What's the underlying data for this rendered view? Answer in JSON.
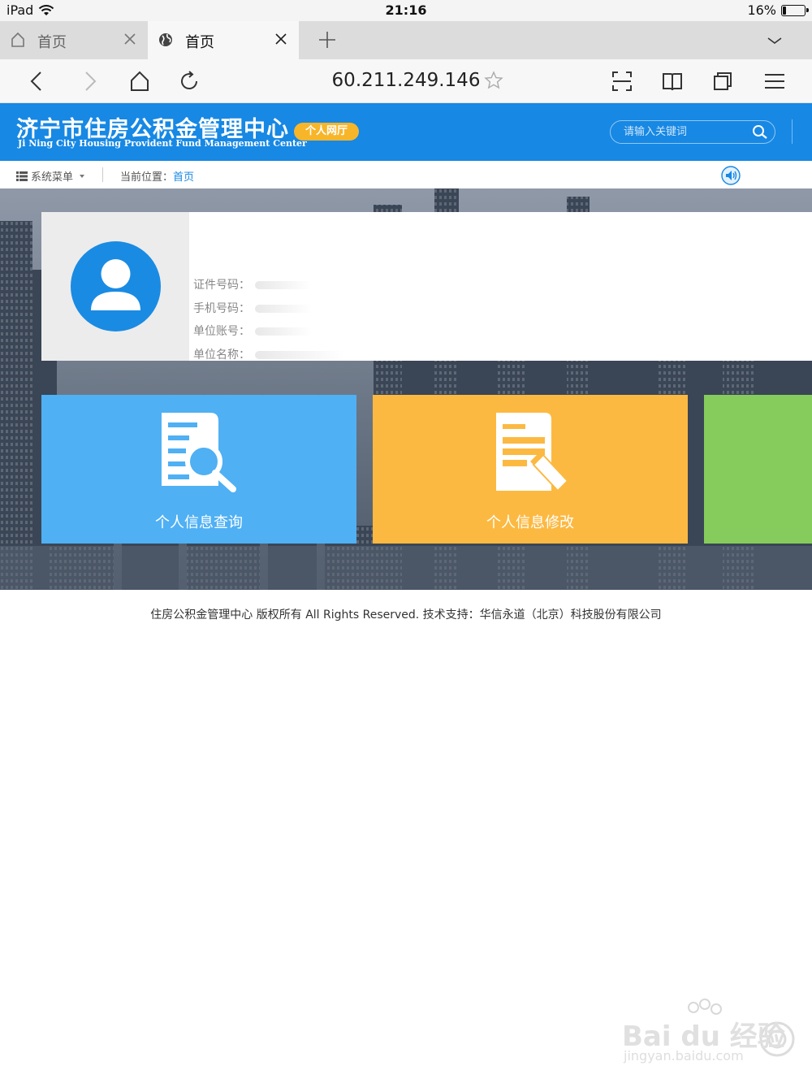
{
  "status_bar": {
    "device": "iPad",
    "time": "21:16",
    "battery": "16%",
    "battery_level": 0.16
  },
  "tabs": [
    {
      "label": "首页"
    },
    {
      "label": "首页"
    }
  ],
  "toolbar": {
    "url": "60.211.249.146"
  },
  "header": {
    "logo_cn": "济宁市住房公积金管理中心",
    "logo_en": "Ji Ning City Housing Provident Fund Management Center",
    "badge": "个人网厅",
    "search_placeholder": "请输入关键词"
  },
  "crumbs": {
    "menu": "系统菜单",
    "location_label": "当前位置：",
    "current": "首页"
  },
  "profile": {
    "fields": [
      {
        "label": "证件号码："
      },
      {
        "label": "手机号码："
      },
      {
        "label": "单位账号："
      },
      {
        "label": "单位名称："
      }
    ]
  },
  "tiles": [
    {
      "label": "个人信息查询",
      "color": "#4fb0f4"
    },
    {
      "label": "个人信息修改",
      "color": "#fcb941"
    },
    {
      "label": "",
      "color": "#86cc5c"
    }
  ],
  "footer": {
    "text": "住房公积金管理中心 版权所有 All Rights Reserved. 技术支持：华信永道（北京）科技股份有限公司"
  },
  "watermark": {
    "text": "Bai du 经验",
    "sub": "jingyan.baidu.com"
  }
}
